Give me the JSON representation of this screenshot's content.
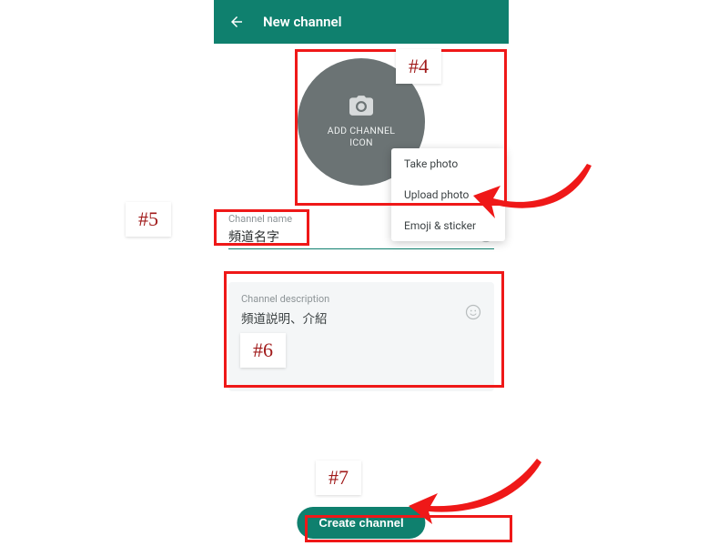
{
  "header": {
    "title": "New channel"
  },
  "avatar": {
    "label_line1": "ADD CHANNEL",
    "label_line2": "ICON"
  },
  "menu": {
    "items": [
      {
        "label": "Take photo"
      },
      {
        "label": "Upload photo"
      },
      {
        "label": "Emoji & sticker"
      }
    ]
  },
  "name_field": {
    "label": "Channel name",
    "value": "頻道名字"
  },
  "desc_field": {
    "label": "Channel description",
    "value": "頻道説明、介紹"
  },
  "create_button": {
    "label": "Create channel"
  },
  "annotations": {
    "tag4": "#4",
    "tag5": "#5",
    "tag6": "#6",
    "tag7": "#7"
  }
}
